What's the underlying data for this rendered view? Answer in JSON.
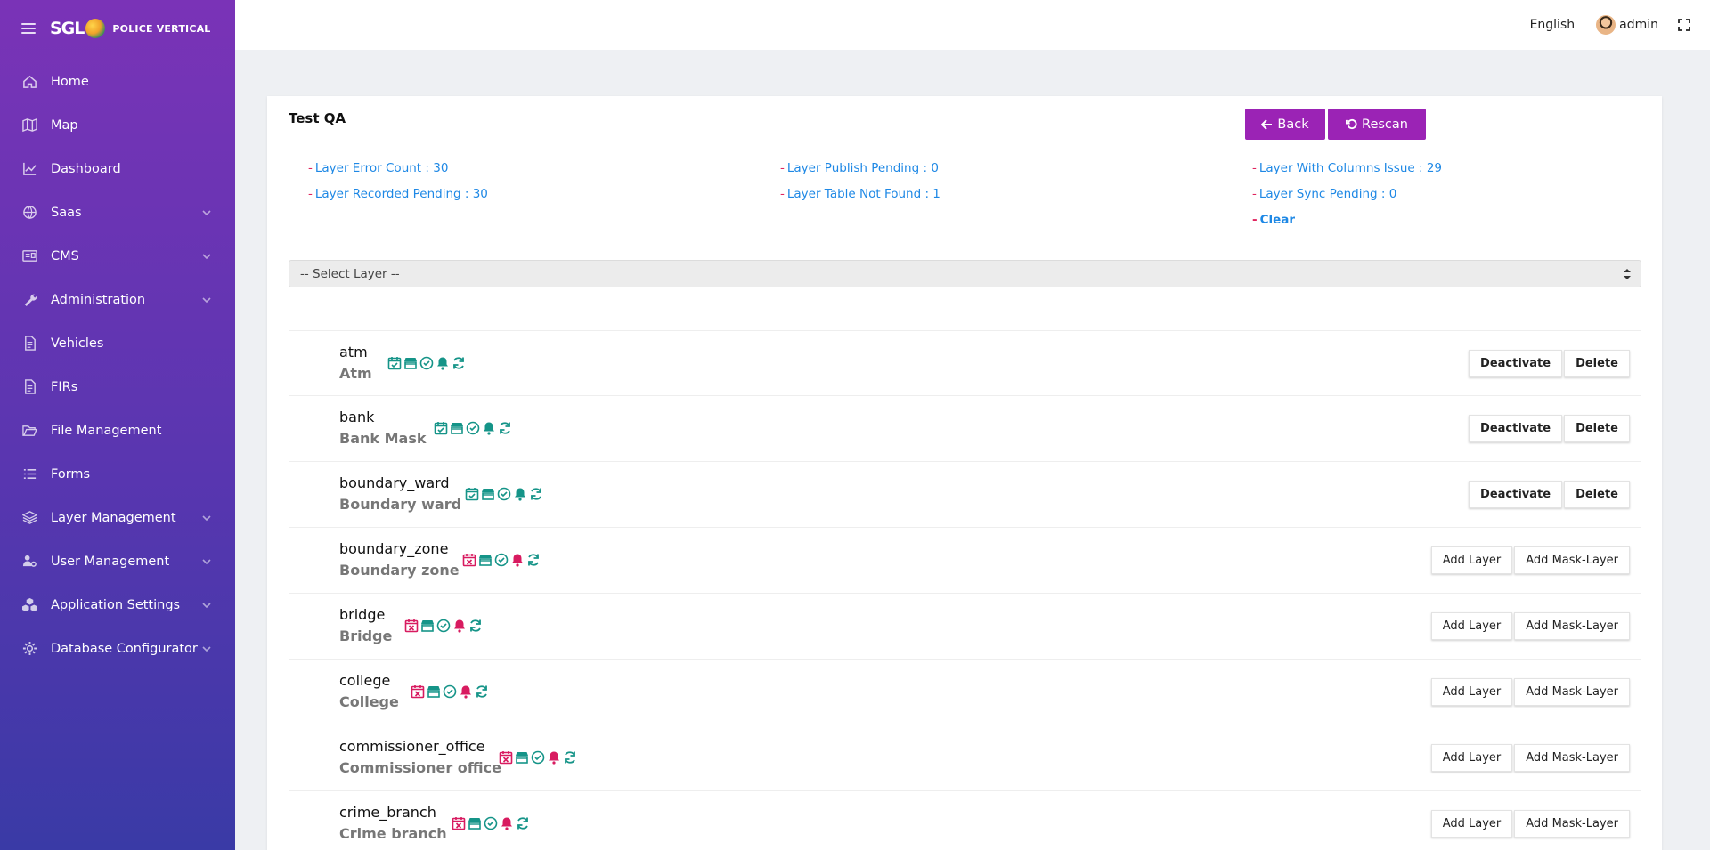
{
  "brand": {
    "logo": "SGL",
    "subtitle": "POLICE VERTICAL"
  },
  "nav": [
    {
      "label": "Home",
      "icon": "home-icon",
      "chevron": false
    },
    {
      "label": "Map",
      "icon": "map-icon",
      "chevron": false
    },
    {
      "label": "Dashboard",
      "icon": "chart-line-icon",
      "chevron": false
    },
    {
      "label": "Saas",
      "icon": "globe-icon",
      "chevron": true
    },
    {
      "label": "CMS",
      "icon": "cms-card-icon",
      "chevron": true
    },
    {
      "label": "Administration",
      "icon": "wrench-icon",
      "chevron": true
    },
    {
      "label": "Vehicles",
      "icon": "document-icon",
      "chevron": false
    },
    {
      "label": "FIRs",
      "icon": "document-icon",
      "chevron": false
    },
    {
      "label": "File Management",
      "icon": "folder-open-icon",
      "chevron": false
    },
    {
      "label": "Forms",
      "icon": "list-icon",
      "chevron": false
    },
    {
      "label": "Layer Management",
      "icon": "layers-icon",
      "chevron": true
    },
    {
      "label": "User Management",
      "icon": "users-cog-icon",
      "chevron": true
    },
    {
      "label": "Application Settings",
      "icon": "cubes-icon",
      "chevron": true
    },
    {
      "label": "Database Configurator",
      "icon": "gear-icon",
      "chevron": true
    }
  ],
  "topbar": {
    "language": "English",
    "username": "admin"
  },
  "card": {
    "title": "Test QA",
    "back_label": "Back",
    "rescan_label": "Rescan",
    "stats": {
      "error_count": "Layer Error Count : 30",
      "recorded_pending": "Layer Recorded Pending : 30",
      "publish_pending": "Layer Publish Pending : 0",
      "table_not_found": "Layer Table Not Found : 1",
      "columns_issue": "Layer With Columns Issue : 29",
      "sync_pending": "Layer Sync Pending : 0",
      "clear": "Clear"
    },
    "select_placeholder": "-- Select Layer --"
  },
  "colors": {
    "ok": "#159488",
    "error": "#d81b60",
    "accent": "#9b23b5",
    "link": "#1e88e5"
  },
  "layers": [
    {
      "name": "atm",
      "label": "Atm",
      "status": "active",
      "record_ok": true,
      "alert_ok": true
    },
    {
      "name": "bank",
      "label": "Bank Mask",
      "status": "active",
      "record_ok": true,
      "alert_ok": true
    },
    {
      "name": "boundary_ward",
      "label": "Boundary ward",
      "status": "active",
      "record_ok": true,
      "alert_ok": true
    },
    {
      "name": "boundary_zone",
      "label": "Boundary zone",
      "status": "missing",
      "record_ok": false,
      "alert_ok": false
    },
    {
      "name": "bridge",
      "label": "Bridge",
      "status": "missing",
      "record_ok": false,
      "alert_ok": false
    },
    {
      "name": "college",
      "label": "College",
      "status": "missing",
      "record_ok": false,
      "alert_ok": false
    },
    {
      "name": "commissioner_office",
      "label": "Commissioner office",
      "status": "missing",
      "record_ok": false,
      "alert_ok": false
    },
    {
      "name": "crime_branch",
      "label": "Crime branch",
      "status": "missing",
      "record_ok": false,
      "alert_ok": false
    }
  ],
  "actions": {
    "active": [
      "Deactivate",
      "Delete"
    ],
    "missing": [
      "Add Layer",
      "Add Mask-Layer"
    ]
  }
}
